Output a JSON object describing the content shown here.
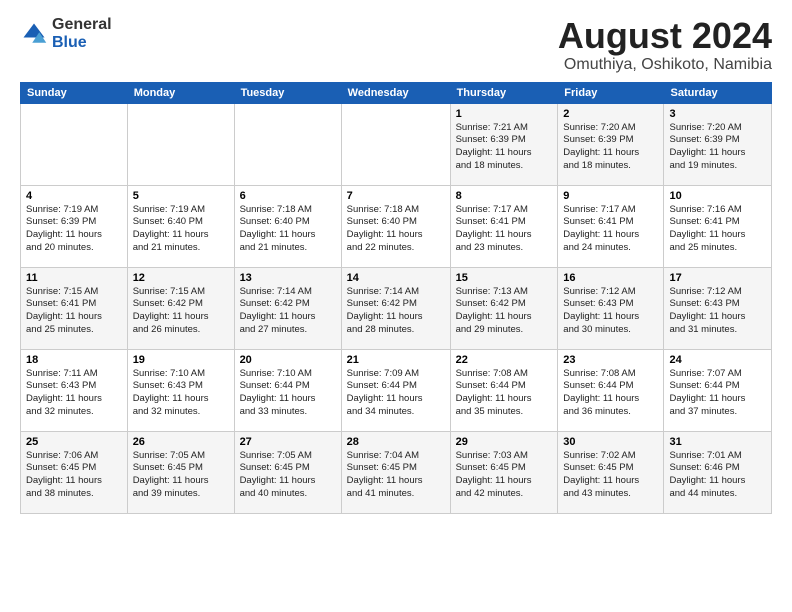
{
  "header": {
    "logo_general": "General",
    "logo_blue": "Blue",
    "title": "August 2024",
    "location": "Omuthiya, Oshikoto, Namibia"
  },
  "weekdays": [
    "Sunday",
    "Monday",
    "Tuesday",
    "Wednesday",
    "Thursday",
    "Friday",
    "Saturday"
  ],
  "weeks": [
    [
      {
        "day": "",
        "info": ""
      },
      {
        "day": "",
        "info": ""
      },
      {
        "day": "",
        "info": ""
      },
      {
        "day": "",
        "info": ""
      },
      {
        "day": "1",
        "info": "Sunrise: 7:21 AM\nSunset: 6:39 PM\nDaylight: 11 hours\nand 18 minutes."
      },
      {
        "day": "2",
        "info": "Sunrise: 7:20 AM\nSunset: 6:39 PM\nDaylight: 11 hours\nand 18 minutes."
      },
      {
        "day": "3",
        "info": "Sunrise: 7:20 AM\nSunset: 6:39 PM\nDaylight: 11 hours\nand 19 minutes."
      }
    ],
    [
      {
        "day": "4",
        "info": "Sunrise: 7:19 AM\nSunset: 6:39 PM\nDaylight: 11 hours\nand 20 minutes."
      },
      {
        "day": "5",
        "info": "Sunrise: 7:19 AM\nSunset: 6:40 PM\nDaylight: 11 hours\nand 21 minutes."
      },
      {
        "day": "6",
        "info": "Sunrise: 7:18 AM\nSunset: 6:40 PM\nDaylight: 11 hours\nand 21 minutes."
      },
      {
        "day": "7",
        "info": "Sunrise: 7:18 AM\nSunset: 6:40 PM\nDaylight: 11 hours\nand 22 minutes."
      },
      {
        "day": "8",
        "info": "Sunrise: 7:17 AM\nSunset: 6:41 PM\nDaylight: 11 hours\nand 23 minutes."
      },
      {
        "day": "9",
        "info": "Sunrise: 7:17 AM\nSunset: 6:41 PM\nDaylight: 11 hours\nand 24 minutes."
      },
      {
        "day": "10",
        "info": "Sunrise: 7:16 AM\nSunset: 6:41 PM\nDaylight: 11 hours\nand 25 minutes."
      }
    ],
    [
      {
        "day": "11",
        "info": "Sunrise: 7:15 AM\nSunset: 6:41 PM\nDaylight: 11 hours\nand 25 minutes."
      },
      {
        "day": "12",
        "info": "Sunrise: 7:15 AM\nSunset: 6:42 PM\nDaylight: 11 hours\nand 26 minutes."
      },
      {
        "day": "13",
        "info": "Sunrise: 7:14 AM\nSunset: 6:42 PM\nDaylight: 11 hours\nand 27 minutes."
      },
      {
        "day": "14",
        "info": "Sunrise: 7:14 AM\nSunset: 6:42 PM\nDaylight: 11 hours\nand 28 minutes."
      },
      {
        "day": "15",
        "info": "Sunrise: 7:13 AM\nSunset: 6:42 PM\nDaylight: 11 hours\nand 29 minutes."
      },
      {
        "day": "16",
        "info": "Sunrise: 7:12 AM\nSunset: 6:43 PM\nDaylight: 11 hours\nand 30 minutes."
      },
      {
        "day": "17",
        "info": "Sunrise: 7:12 AM\nSunset: 6:43 PM\nDaylight: 11 hours\nand 31 minutes."
      }
    ],
    [
      {
        "day": "18",
        "info": "Sunrise: 7:11 AM\nSunset: 6:43 PM\nDaylight: 11 hours\nand 32 minutes."
      },
      {
        "day": "19",
        "info": "Sunrise: 7:10 AM\nSunset: 6:43 PM\nDaylight: 11 hours\nand 32 minutes."
      },
      {
        "day": "20",
        "info": "Sunrise: 7:10 AM\nSunset: 6:44 PM\nDaylight: 11 hours\nand 33 minutes."
      },
      {
        "day": "21",
        "info": "Sunrise: 7:09 AM\nSunset: 6:44 PM\nDaylight: 11 hours\nand 34 minutes."
      },
      {
        "day": "22",
        "info": "Sunrise: 7:08 AM\nSunset: 6:44 PM\nDaylight: 11 hours\nand 35 minutes."
      },
      {
        "day": "23",
        "info": "Sunrise: 7:08 AM\nSunset: 6:44 PM\nDaylight: 11 hours\nand 36 minutes."
      },
      {
        "day": "24",
        "info": "Sunrise: 7:07 AM\nSunset: 6:44 PM\nDaylight: 11 hours\nand 37 minutes."
      }
    ],
    [
      {
        "day": "25",
        "info": "Sunrise: 7:06 AM\nSunset: 6:45 PM\nDaylight: 11 hours\nand 38 minutes."
      },
      {
        "day": "26",
        "info": "Sunrise: 7:05 AM\nSunset: 6:45 PM\nDaylight: 11 hours\nand 39 minutes."
      },
      {
        "day": "27",
        "info": "Sunrise: 7:05 AM\nSunset: 6:45 PM\nDaylight: 11 hours\nand 40 minutes."
      },
      {
        "day": "28",
        "info": "Sunrise: 7:04 AM\nSunset: 6:45 PM\nDaylight: 11 hours\nand 41 minutes."
      },
      {
        "day": "29",
        "info": "Sunrise: 7:03 AM\nSunset: 6:45 PM\nDaylight: 11 hours\nand 42 minutes."
      },
      {
        "day": "30",
        "info": "Sunrise: 7:02 AM\nSunset: 6:45 PM\nDaylight: 11 hours\nand 43 minutes."
      },
      {
        "day": "31",
        "info": "Sunrise: 7:01 AM\nSunset: 6:46 PM\nDaylight: 11 hours\nand 44 minutes."
      }
    ]
  ]
}
